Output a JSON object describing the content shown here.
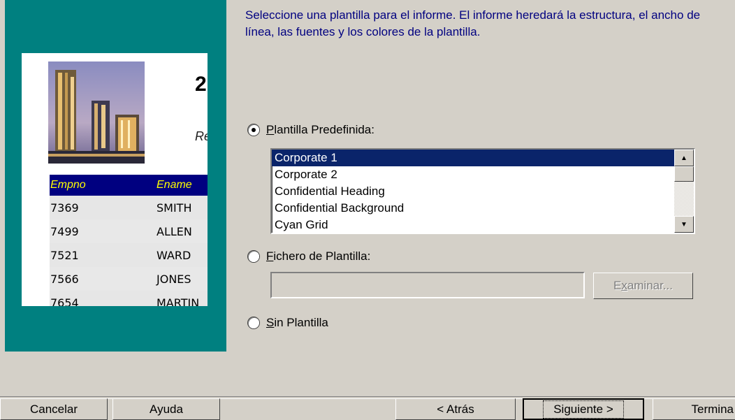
{
  "instruction": "Seleccione una plantilla para el informe. El informe heredará la estructura, el ancho de línea, las fuentes y los colores de la plantilla.",
  "preview": {
    "title": "2",
    "subtitle": "Re",
    "headers": [
      "Empno",
      "Ename"
    ],
    "rows": [
      [
        "7369",
        "SMITH"
      ],
      [
        "7499",
        "ALLEN"
      ],
      [
        "7521",
        "WARD"
      ],
      [
        "7566",
        "JONES"
      ],
      [
        "7654",
        "MARTIN"
      ]
    ]
  },
  "options": {
    "predefined": {
      "mnemonic": "P",
      "rest": "lantilla Predefinida:",
      "checked": true
    },
    "file": {
      "mnemonic": "F",
      "rest": "ichero de Plantilla:",
      "checked": false
    },
    "none": {
      "mnemonic": "S",
      "rest": "in Plantilla",
      "checked": false
    }
  },
  "templates": [
    "Corporate 1",
    "Corporate 2",
    "Confidential Heading",
    "Confidential Background",
    "Cyan Grid"
  ],
  "selected_template": "Corporate 1",
  "file_value": "",
  "browse": {
    "pre": "E",
    "mnemonic": "x",
    "post": "aminar..."
  },
  "buttons": {
    "cancel": "Cancelar",
    "help": "Ayuda",
    "back": "< Atrás",
    "next": "Siguiente >",
    "finish": "Termina"
  },
  "colors": {
    "panel": "#008080",
    "selection": "#0a246a",
    "header": "#000080",
    "header_text": "#ffff00"
  }
}
